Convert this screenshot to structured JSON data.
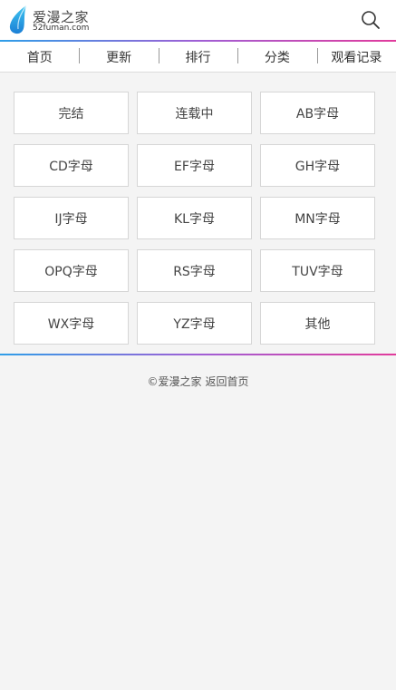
{
  "header": {
    "logo_name": "爱漫之家",
    "logo_url": "52fuman.com",
    "icons": {
      "logo": "droplet-logo-icon",
      "search": "search-icon"
    },
    "colors": {
      "gradient_start": "#2f9ee8",
      "gradient_mid": "#a05fd5",
      "gradient_end": "#e13b9c"
    }
  },
  "nav": {
    "items": [
      {
        "label": "首页"
      },
      {
        "label": "更新"
      },
      {
        "label": "排行"
      },
      {
        "label": "分类"
      },
      {
        "label": "观看记录"
      }
    ]
  },
  "categories": [
    {
      "label": "完结"
    },
    {
      "label": "连载中"
    },
    {
      "label": "AB字母"
    },
    {
      "label": "CD字母"
    },
    {
      "label": "EF字母"
    },
    {
      "label": "GH字母"
    },
    {
      "label": "IJ字母"
    },
    {
      "label": "KL字母"
    },
    {
      "label": "MN字母"
    },
    {
      "label": "OPQ字母"
    },
    {
      "label": "RS字母"
    },
    {
      "label": "TUV字母"
    },
    {
      "label": "WX字母"
    },
    {
      "label": "YZ字母"
    },
    {
      "label": "其他"
    }
  ],
  "footer": {
    "copyright": "©爱漫之家",
    "home_link": "返回首页"
  }
}
